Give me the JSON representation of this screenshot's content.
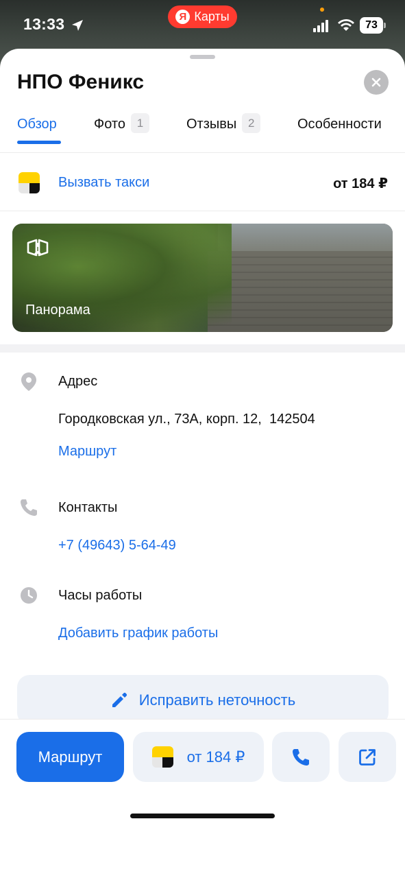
{
  "status_bar": {
    "time": "13:33",
    "app_pill_badge": "Я",
    "app_pill_label": "Карты",
    "battery": "73"
  },
  "place": {
    "title": "НПО Феникс"
  },
  "tabs": [
    {
      "label": "Обзор",
      "count": "",
      "active": true
    },
    {
      "label": "Фото",
      "count": "1",
      "active": false
    },
    {
      "label": "Отзывы",
      "count": "2",
      "active": false
    },
    {
      "label": "Особенности",
      "count": "",
      "active": false
    }
  ],
  "taxi": {
    "label": "Вызвать такси",
    "price": "от 184 ₽"
  },
  "panorama": {
    "label": "Панорама"
  },
  "address": {
    "heading": "Адрес",
    "text": "Городковская ул., 73А, корп. 12,  142504",
    "link": "Маршрут"
  },
  "contacts": {
    "heading": "Контакты",
    "phone": "+7 (49643) 5-64-49"
  },
  "hours": {
    "heading": "Часы работы",
    "link": "Добавить график работы"
  },
  "fix_button": {
    "label": "Исправить неточность"
  },
  "bottom_bar": {
    "route_label": "Маршрут",
    "taxi_price": "от 184 ₽"
  },
  "colors": {
    "accent": "#1a6ee8",
    "taxi_yellow": "#ffd200",
    "status_pill": "#ff3b30"
  }
}
